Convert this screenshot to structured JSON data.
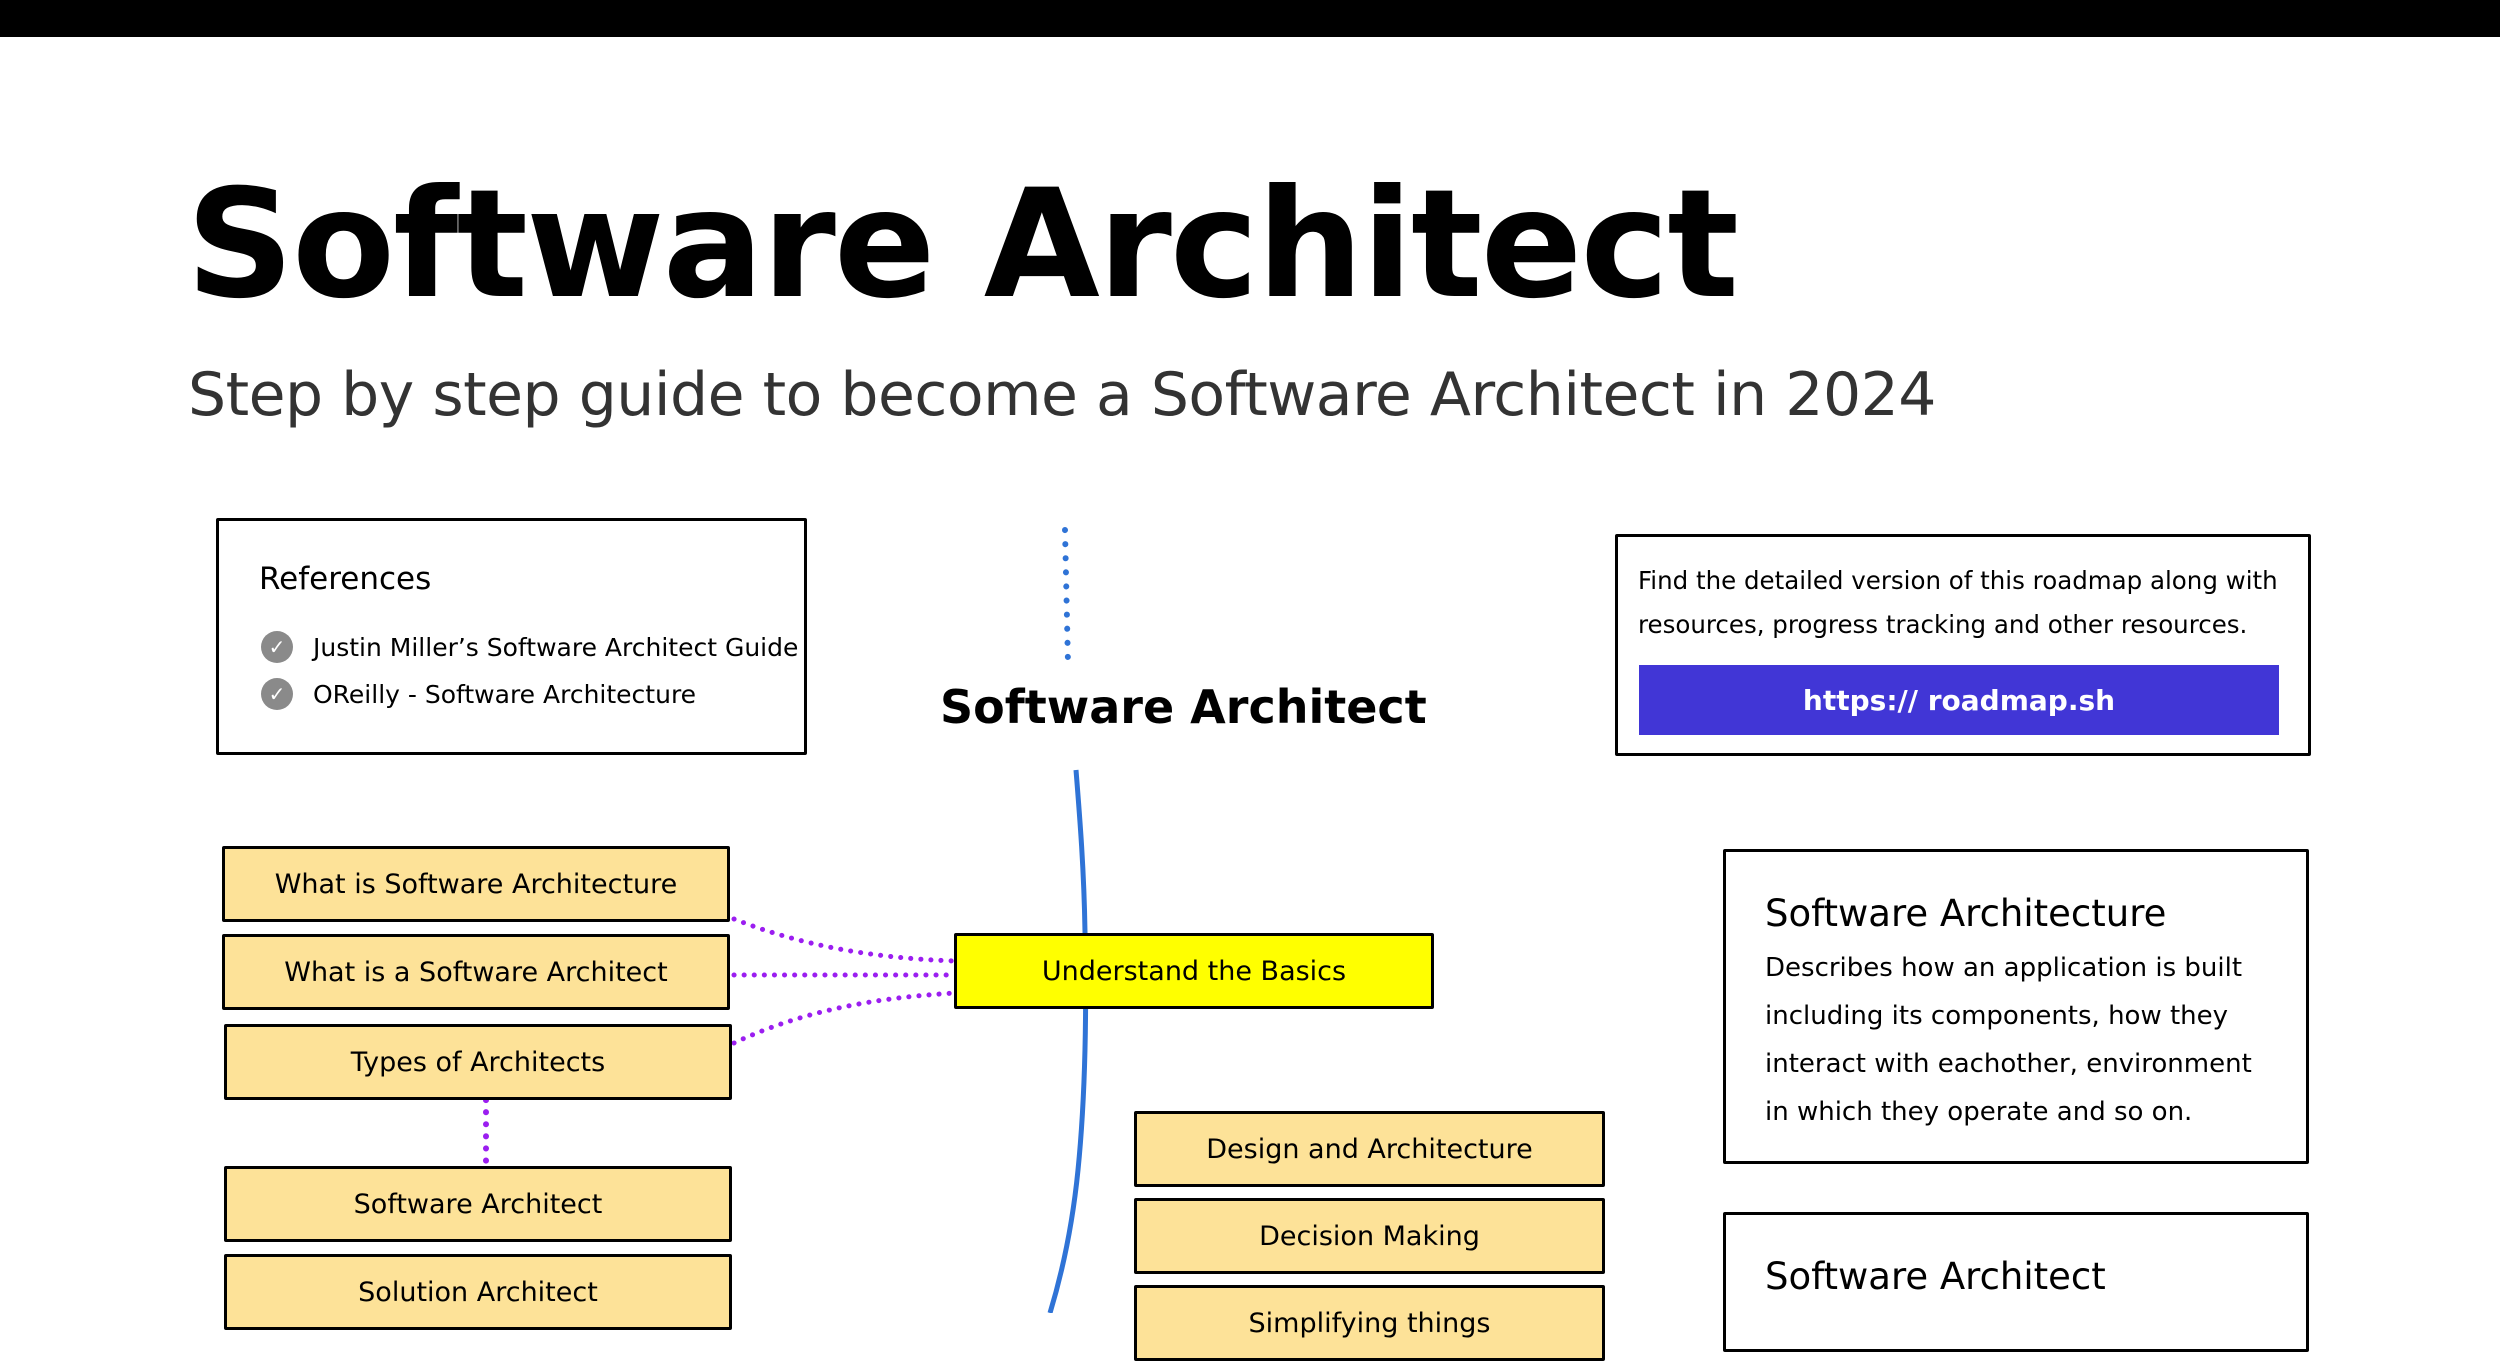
{
  "header": {
    "title": "Software Architect",
    "subtitle": "Step by step guide to become a Software Architect in 2024"
  },
  "references": {
    "title": "References",
    "items": [
      {
        "label": "Justin Miller’s Software Architect Guide"
      },
      {
        "label": "OReilly - Software Architecture"
      }
    ]
  },
  "promo": {
    "text": "Find the detailed version of this roadmap along with resources, progress tracking and other resources.",
    "link_label": "https:// roadmap.sh"
  },
  "roadmap": {
    "title": "Software Architect",
    "topic": "Understand the Basics",
    "left_nodes": [
      "What is Software Architecture",
      "What is a Software Architect",
      "Types of Architects"
    ],
    "architect_types": [
      "Software Architect",
      "Solution Architect"
    ],
    "skills": [
      "Design and Architecture",
      "Decision Making",
      "Simplifying things"
    ]
  },
  "info_cards": [
    {
      "title": "Software Architecture",
      "text": "Describes how an application is built\nincluding its components, how they\ninteract with eachother, environment\n in which they operate and so on."
    },
    {
      "title": "Software Architect",
      "text": ""
    }
  ],
  "colors": {
    "topic": "#ffff00",
    "node": "#fde298",
    "link_button": "#4136d6",
    "spine": "#2f73d6",
    "dotted_connector": "#9b1ef0"
  }
}
